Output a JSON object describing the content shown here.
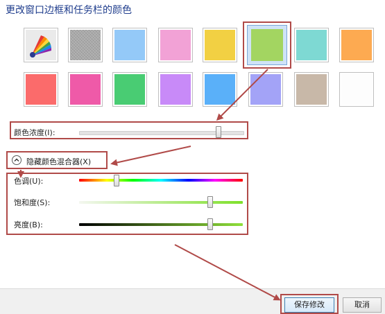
{
  "page": {
    "title": "更改窗口边框和任务栏的颜色"
  },
  "colors": {
    "row1": [
      {
        "name": "automatic",
        "hex": "rainbow"
      },
      {
        "name": "gray",
        "hex": "#a8a8a8"
      },
      {
        "name": "sky-blue",
        "hex": "#94c9f8"
      },
      {
        "name": "pink",
        "hex": "#f2a2d6"
      },
      {
        "name": "yellow",
        "hex": "#f2d043"
      },
      {
        "name": "green",
        "hex": "#a3d561",
        "selected": true
      },
      {
        "name": "teal",
        "hex": "#7ed9d3"
      },
      {
        "name": "orange",
        "hex": "#fdaa51"
      }
    ],
    "row2": [
      {
        "name": "red",
        "hex": "#fb6b6b"
      },
      {
        "name": "magenta",
        "hex": "#ef5aa8"
      },
      {
        "name": "emerald",
        "hex": "#49cc73"
      },
      {
        "name": "violet",
        "hex": "#c88af8"
      },
      {
        "name": "blue",
        "hex": "#5ab0f9"
      },
      {
        "name": "lavender",
        "hex": "#a3a3f7"
      },
      {
        "name": "taupe",
        "hex": "#c8b8a8"
      },
      {
        "name": "white",
        "hex": "#fdfdfd"
      }
    ]
  },
  "intensity": {
    "label": "颜色浓度(I):",
    "value": 0.85
  },
  "mixer": {
    "toggle_label": "隐藏颜色混合器(X)",
    "hue_label": "色调(U):",
    "hue_value": 0.23,
    "saturation_label": "饱和度(S):",
    "saturation_value": 0.8,
    "brightness_label": "亮度(B):",
    "brightness_value": 0.8
  },
  "buttons": {
    "save": "保存修改",
    "cancel": "取消"
  },
  "accent": {
    "annotation": "#b04a48",
    "title": "#1e3c8c"
  }
}
